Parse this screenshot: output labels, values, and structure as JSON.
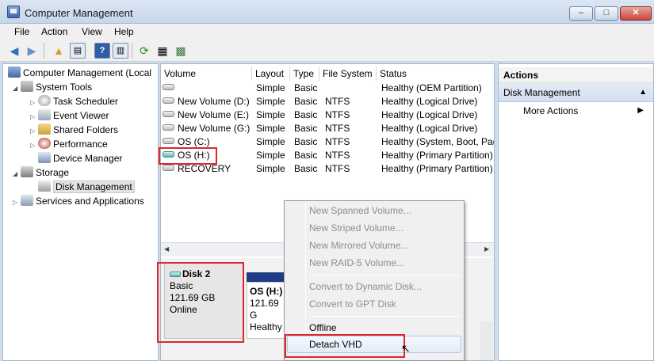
{
  "window": {
    "title": "Computer Management",
    "minimize": "–",
    "maximize": "□",
    "close": "✕"
  },
  "menu": [
    "File",
    "Action",
    "View",
    "Help"
  ],
  "toolbar": [
    "back-icon",
    "forward-icon",
    "up-folder-icon",
    "show-hide-tree-icon",
    "help-icon",
    "show-hide-action-icon",
    "refresh-icon",
    "properties-icon",
    "export-icon"
  ],
  "tree": {
    "root": "Computer Management (Local",
    "items": [
      {
        "label": "System Tools"
      },
      {
        "label": "Task Scheduler"
      },
      {
        "label": "Event Viewer"
      },
      {
        "label": "Shared Folders"
      },
      {
        "label": "Performance"
      },
      {
        "label": "Device Manager"
      },
      {
        "label": "Storage"
      },
      {
        "label": "Disk Management"
      },
      {
        "label": "Services and Applications"
      }
    ]
  },
  "volumes": {
    "columns": [
      "Volume",
      "Layout",
      "Type",
      "File System",
      "Status"
    ],
    "rows": [
      [
        "",
        "Simple",
        "Basic",
        "",
        "Healthy (OEM Partition)"
      ],
      [
        "New Volume (D:)",
        "Simple",
        "Basic",
        "NTFS",
        "Healthy (Logical Drive)"
      ],
      [
        "New Volume (E:)",
        "Simple",
        "Basic",
        "NTFS",
        "Healthy (Logical Drive)"
      ],
      [
        "New Volume (G:)",
        "Simple",
        "Basic",
        "NTFS",
        "Healthy (Logical Drive)"
      ],
      [
        "OS (C:)",
        "Simple",
        "Basic",
        "NTFS",
        "Healthy (System, Boot, Pag"
      ],
      [
        "OS (H:)",
        "Simple",
        "Basic",
        "NTFS",
        "Healthy (Primary Partition)"
      ],
      [
        "RECOVERY",
        "Simple",
        "Basic",
        "NTFS",
        "Healthy (Primary Partition)"
      ]
    ]
  },
  "disk": {
    "name": "Disk 2",
    "type": "Basic",
    "size": "121.69 GB",
    "status": "Online"
  },
  "partition": {
    "name": "OS  (H:)",
    "size": "121.69 G",
    "status": "Healthy"
  },
  "actions": {
    "header": "Actions",
    "section": "Disk Management",
    "more": "More Actions"
  },
  "context_menu": {
    "items": [
      {
        "label": "New Spanned Volume...",
        "enabled": false
      },
      {
        "label": "New Striped Volume...",
        "enabled": false
      },
      {
        "label": "New Mirrored Volume...",
        "enabled": false
      },
      {
        "label": "New RAID-5 Volume...",
        "enabled": false
      },
      {
        "label": "Convert to Dynamic Disk...",
        "enabled": false
      },
      {
        "label": "Convert to GPT Disk",
        "enabled": false
      },
      {
        "label": "Offline",
        "enabled": true
      },
      {
        "label": "Detach VHD",
        "enabled": true
      }
    ]
  },
  "colors": {
    "highlight_box": "#e0262b",
    "partition_bar": "#1f3b86",
    "title_bar": "#cfdcec"
  }
}
